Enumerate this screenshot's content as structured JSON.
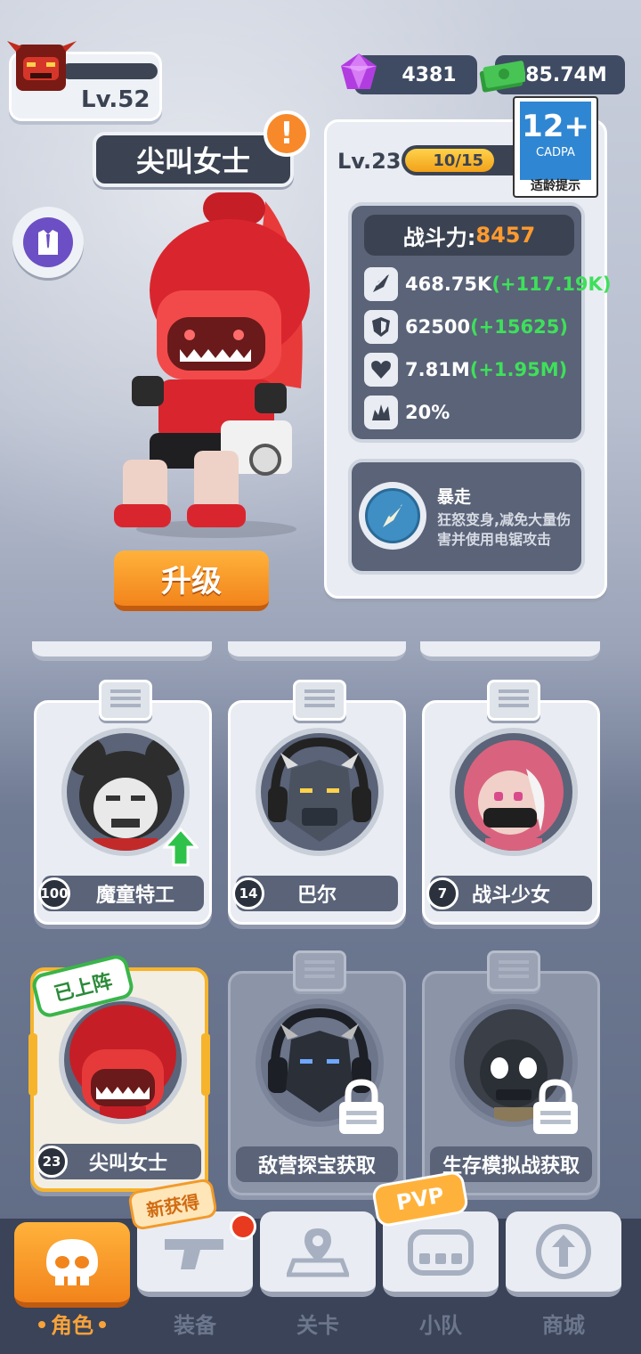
{
  "player": {
    "level_label": "Lv.52"
  },
  "currency": {
    "gems": "4381",
    "cash": "85.74M"
  },
  "rating": {
    "age": "12+",
    "org": "CADPA",
    "tip": "适龄提示"
  },
  "hero": {
    "name": "尖叫女士",
    "alert": "!",
    "upgrade_label": "升级",
    "level_label": "Lv.23",
    "xp_text": "10/15",
    "xp_fraction": 0.667,
    "power_label": "战斗力:",
    "power_value": "8457",
    "stats": [
      {
        "icon": "attack-icon",
        "value": "468.75K",
        "bonus": "(+117.19K)"
      },
      {
        "icon": "defense-icon",
        "value": "62500",
        "bonus": "(+15625)"
      },
      {
        "icon": "health-icon",
        "value": "7.81M",
        "bonus": "(+1.95M)"
      },
      {
        "icon": "crit-icon",
        "value": "20%",
        "bonus": ""
      }
    ],
    "skill": {
      "name": "暴走",
      "desc": "狂怒变身,减免大量伤害并使用电锯攻击"
    }
  },
  "roster": [
    {
      "name": "魔童特工",
      "level": "100",
      "upgradable": true,
      "locked": false
    },
    {
      "name": "巴尔",
      "level": "14",
      "upgradable": false,
      "locked": false
    },
    {
      "name": "战斗少女",
      "level": "7",
      "upgradable": false,
      "locked": false
    },
    {
      "name": "尖叫女士",
      "level": "23",
      "deployed_label": "已上阵",
      "selected": true,
      "locked": false
    },
    {
      "name": "敌营探宝获取",
      "level": "",
      "locked": true
    },
    {
      "name": "生存模拟战获取",
      "level": "",
      "locked": true
    }
  ],
  "nav": {
    "items": [
      {
        "label": "角色",
        "icon": "skull-icon",
        "active": true
      },
      {
        "label": "装备",
        "icon": "gun-icon"
      },
      {
        "label": "关卡",
        "icon": "map-pin-icon"
      },
      {
        "label": "小队",
        "icon": "controller-icon"
      },
      {
        "label": "商城",
        "icon": "shop-icon"
      }
    ],
    "new_tag": "新获得",
    "pvp_tag": "PVP"
  },
  "colors": {
    "accent": "#f2841c",
    "panel": "#5a6378",
    "bonus": "#3ee05a",
    "power": "#ff9a2e"
  }
}
